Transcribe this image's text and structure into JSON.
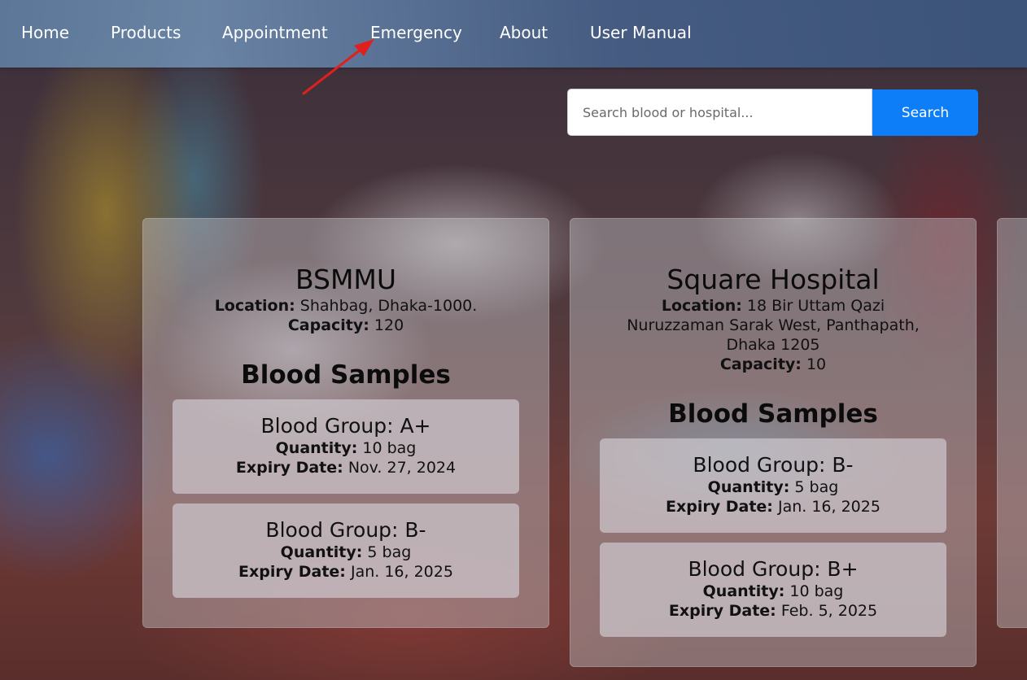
{
  "nav": {
    "items": [
      "Home",
      "Products",
      "Appointment",
      "Emergency",
      "About",
      "User Manual"
    ]
  },
  "search": {
    "placeholder": "Search blood or hospital...",
    "button_label": "Search"
  },
  "labels": {
    "location": "Location:",
    "capacity": "Capacity:",
    "blood_samples": "Blood Samples",
    "quantity": "Quantity:",
    "expiry_date": "Expiry Date:"
  },
  "hospitals": [
    {
      "name": "BSMMU",
      "location": "Shahbag, Dhaka-1000.",
      "capacity": "120",
      "samples": [
        {
          "group": "Blood Group: A+",
          "quantity": "10 bag",
          "expiry": "Nov. 27, 2024"
        },
        {
          "group": "Blood Group: B-",
          "quantity": "5 bag",
          "expiry": "Jan. 16, 2025"
        }
      ]
    },
    {
      "name": "Square Hospital",
      "location_lines": [
        "18 Bir Uttam Qazi",
        "Nuruzzaman Sarak West, Panthapath,",
        "Dhaka 1205"
      ],
      "capacity": "10",
      "samples": [
        {
          "group": "Blood Group: B-",
          "quantity": "5 bag",
          "expiry": "Jan. 16, 2025"
        },
        {
          "group": "Blood Group: B+",
          "quantity": "10 bag",
          "expiry": "Feb. 5, 2025"
        }
      ]
    }
  ],
  "colors": {
    "search_button": "#0d7ef7",
    "annotation_arrow": "#e0201e"
  }
}
